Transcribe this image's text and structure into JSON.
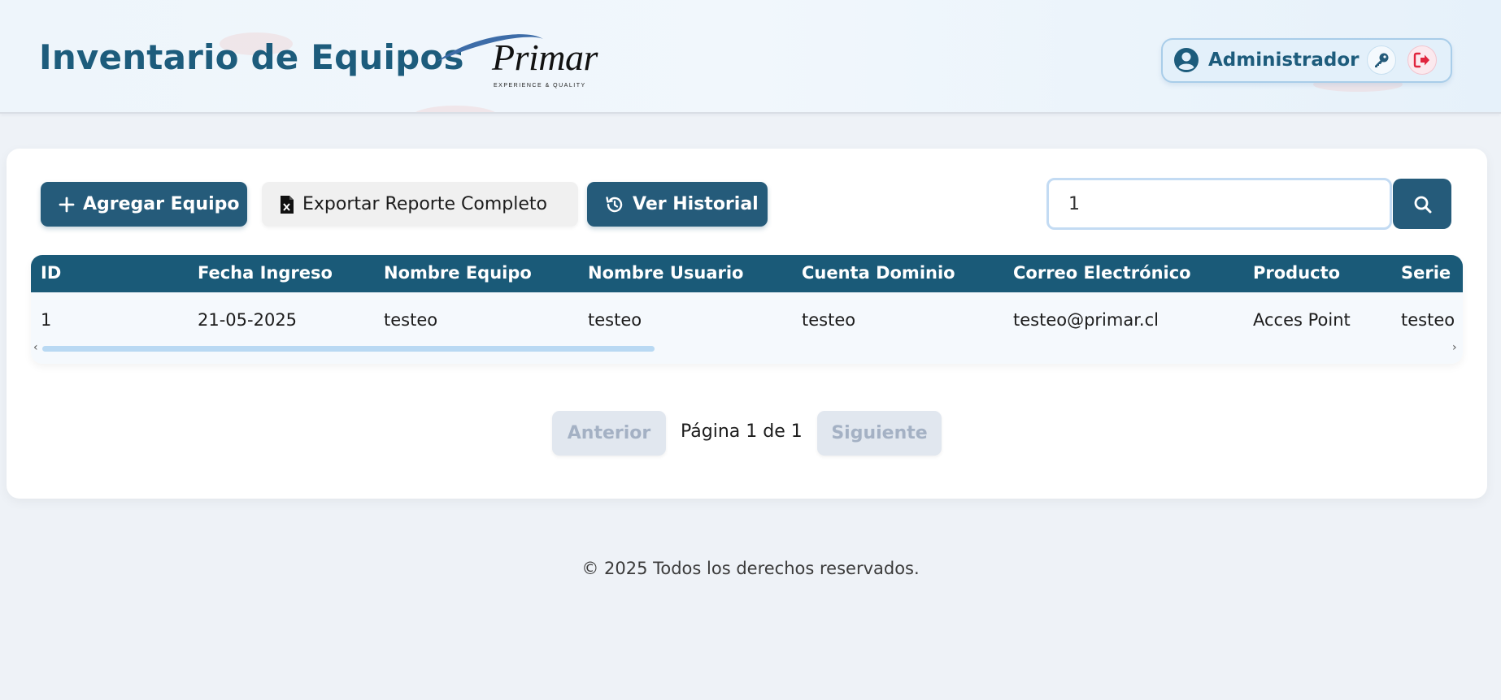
{
  "header": {
    "title": "Inventario de Equipos",
    "logo": {
      "word": "Primar",
      "tagline": "EXPERIENCE & QUALITY"
    },
    "user": {
      "name": "Administrador"
    },
    "icons": {
      "user": "user-circle-icon",
      "key": "key-icon",
      "logout": "logout-icon"
    }
  },
  "toolbar": {
    "add_label": "Agregar Equipo",
    "export_label": "Exportar Reporte Completo",
    "history_label": "Ver Historial",
    "search_value": "1"
  },
  "table": {
    "columns": [
      "ID",
      "Fecha Ingreso",
      "Nombre Equipo",
      "Nombre Usuario",
      "Cuenta Dominio",
      "Correo Electrónico",
      "Producto",
      "Serie"
    ],
    "rows": [
      [
        "1",
        "21-05-2025",
        "testeo",
        "testeo",
        "testeo",
        "testeo@primar.cl",
        "Acces Point",
        "testeo"
      ]
    ]
  },
  "pagination": {
    "prev_label": "Anterior",
    "info": "Página 1 de 1",
    "next_label": "Siguiente"
  },
  "footer": {
    "text": "© 2025 Todos los derechos reservados."
  },
  "colors": {
    "primary": "#255b7a",
    "table_header": "#1a5a78",
    "title": "#1d5c7c",
    "logout": "#e0243d"
  }
}
